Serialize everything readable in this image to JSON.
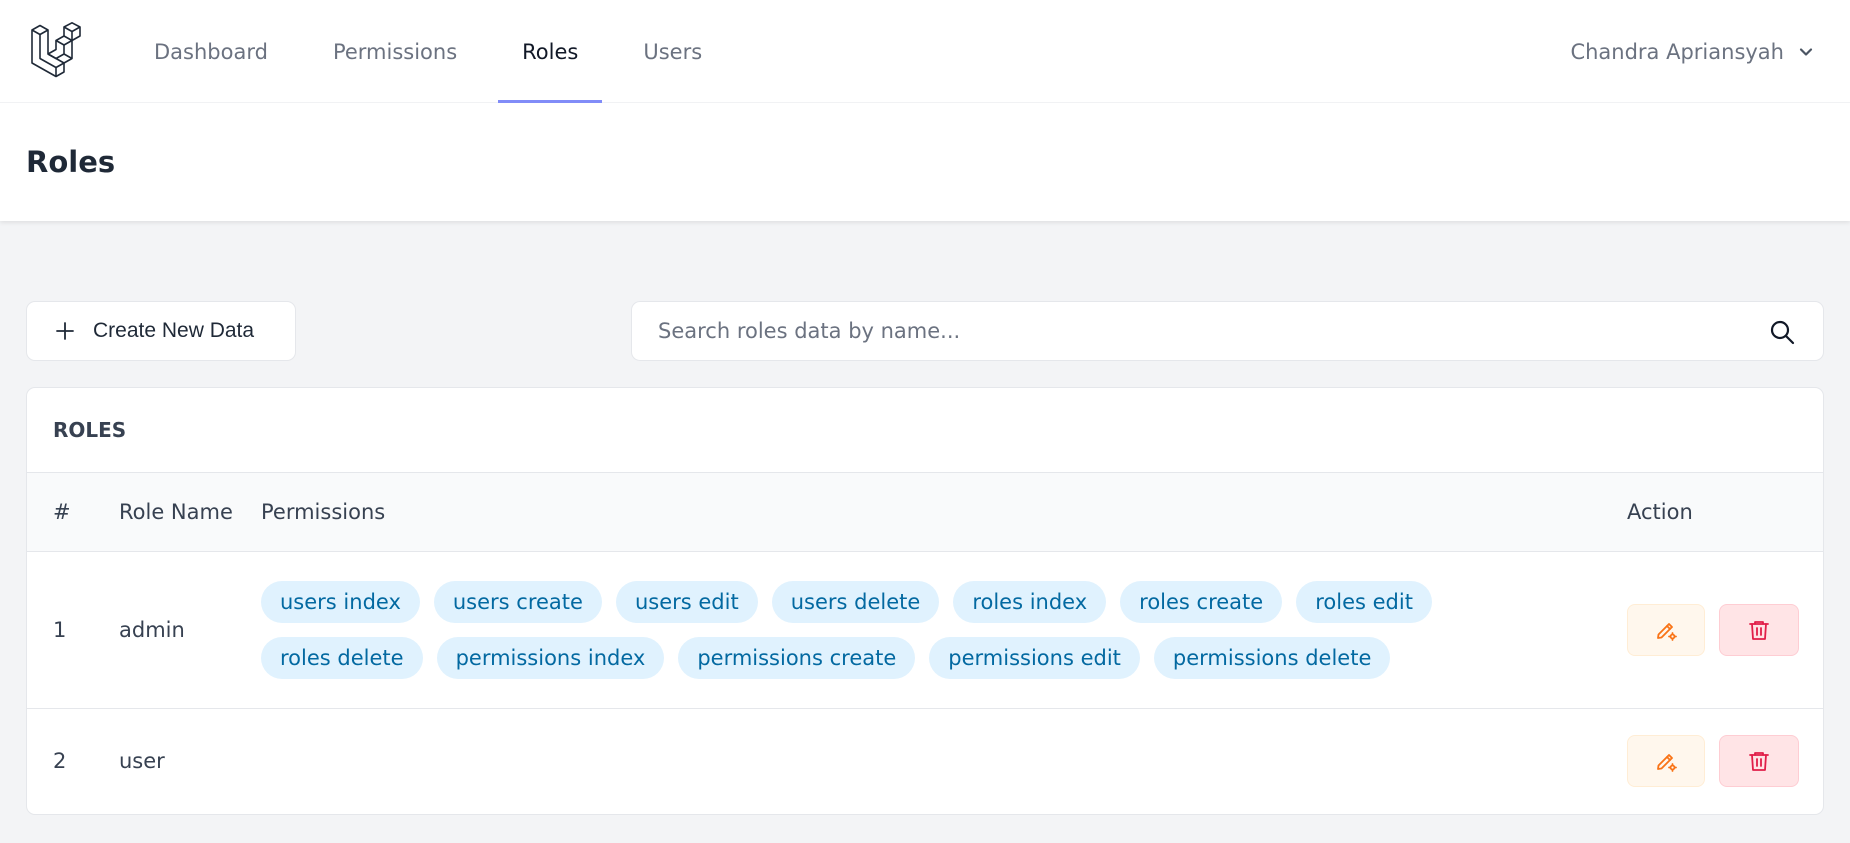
{
  "nav": {
    "items": [
      {
        "label": "Dashboard",
        "active": false
      },
      {
        "label": "Permissions",
        "active": false
      },
      {
        "label": "Roles",
        "active": true
      },
      {
        "label": "Users",
        "active": false
      }
    ],
    "user_name": "Chandra Apriansyah",
    "active_underline_color": "#818cf8"
  },
  "page": {
    "title": "Roles"
  },
  "toolbar": {
    "create_label": "Create New Data",
    "search_placeholder": "Search roles data by name..."
  },
  "table": {
    "title": "ROLES",
    "headers": [
      "#",
      "Role Name",
      "Permissions",
      "Action"
    ],
    "rows": [
      {
        "num": "1",
        "name": "admin",
        "permissions": [
          "users index",
          "users create",
          "users edit",
          "users delete",
          "roles index",
          "roles create",
          "roles edit",
          "roles delete",
          "permissions index",
          "permissions create",
          "permissions edit",
          "permissions delete"
        ]
      },
      {
        "num": "2",
        "name": "user",
        "permissions": []
      }
    ]
  },
  "colors": {
    "badge_bg": "#e0f2fe",
    "badge_text": "#0369a1",
    "edit_bg": "#fff7ed",
    "edit_icon": "#f97316",
    "delete_bg": "#ffe4e6",
    "delete_icon": "#e11d48"
  }
}
